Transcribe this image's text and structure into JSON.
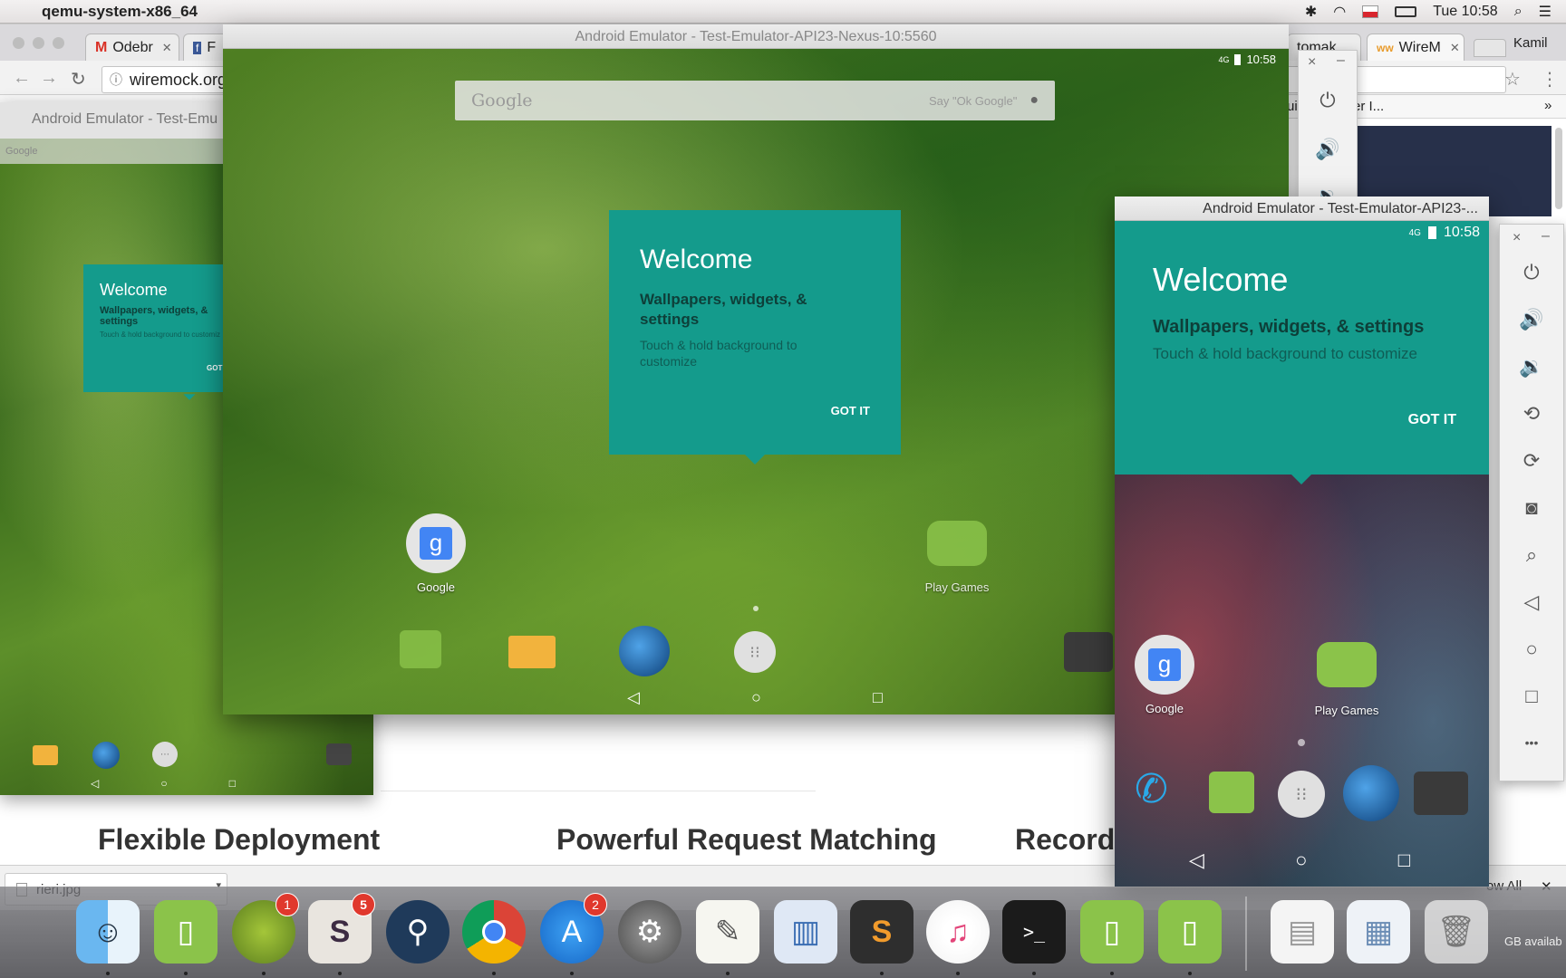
{
  "menubar": {
    "app_name": "qemu-system-x86_64",
    "clock": "Tue 10:58"
  },
  "chrome": {
    "tabs": [
      {
        "label": "Odebr"
      },
      {
        "label": "F"
      },
      {
        "label": "tomak"
      },
      {
        "label": "WireM"
      }
    ],
    "profile_name": "Kamil",
    "address": "wiremock.org",
    "bookmark_partial": "ui",
    "bookmark_partial2": "cker I...",
    "bookmarks_more": "»",
    "features": [
      {
        "label": "Flexible Deployment"
      },
      {
        "label": "Powerful Request Matching"
      },
      {
        "label": "Record"
      }
    ],
    "download": {
      "filename": "rieri.jpg",
      "show_all_label": "ow All",
      "close_label": "✕"
    },
    "partial_storage": "GB availab"
  },
  "emulator_left": {
    "title": "Android Emulator - Test-Emu",
    "search_label": "Google",
    "welcome_title": "Welcome",
    "welcome_sub": "Wallpapers, widgets, & settings",
    "welcome_desc": "Touch & hold background to customiz",
    "got_it": "GOT"
  },
  "emulator_main": {
    "title": "Android Emulator - Test-Emulator-API23-Nexus-10:5560",
    "status_time": "10:58",
    "status_network": "4G",
    "search_label": "Google",
    "search_hint": "Say \"Ok Google\"",
    "welcome_title": "Welcome",
    "welcome_sub": "Wallpapers, widgets, & settings",
    "welcome_desc": "Touch & hold background to customize",
    "got_it": "GOT IT",
    "apps": [
      {
        "label": "Google"
      },
      {
        "label": "Play Games"
      }
    ]
  },
  "emulator_right": {
    "title": "Android Emulator - Test-Emulator-API23-...",
    "status_time": "10:58",
    "status_network": "4G",
    "welcome_title": "Welcome",
    "welcome_sub": "Wallpapers, widgets, & settings",
    "welcome_desc": "Touch & hold background to customize",
    "got_it": "GOT IT",
    "apps": [
      {
        "label": "Google"
      },
      {
        "label": "Play Games"
      }
    ]
  },
  "controls": {
    "close": "×",
    "minimize": "–",
    "more": "•••"
  },
  "dock": {
    "badges": {
      "android_studio": "1",
      "slack": "5",
      "app_store": "2"
    }
  },
  "colors": {
    "welcome_teal": "#149b8c",
    "badge_red": "#e0382d"
  }
}
